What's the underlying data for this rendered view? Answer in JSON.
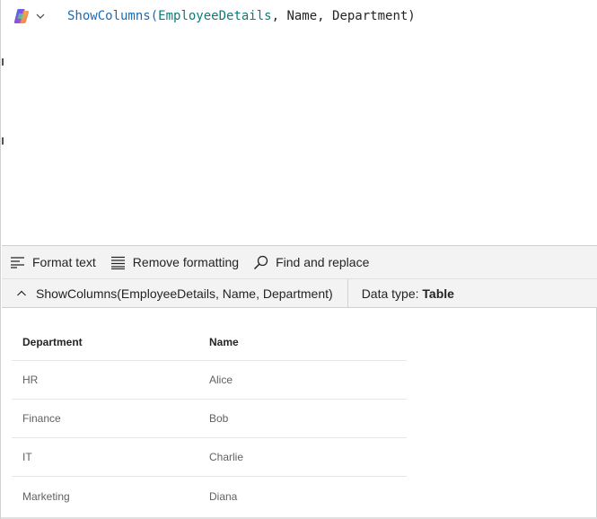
{
  "formula": {
    "function_name": "ShowColumns",
    "open_paren": "(",
    "table_arg": "EmployeeDetails",
    "rest": ", Name, Department)"
  },
  "toolbar": {
    "format_text": "Format text",
    "remove_formatting": "Remove formatting",
    "find_replace": "Find and replace"
  },
  "result": {
    "expression": "ShowColumns(EmployeeDetails, Name, Department)",
    "data_type_label": "Data type:",
    "data_type_value": "Table"
  },
  "table": {
    "headers": [
      "Department",
      "Name"
    ],
    "rows": [
      [
        "HR",
        "Alice"
      ],
      [
        "Finance",
        "Bob"
      ],
      [
        "IT",
        "Charlie"
      ],
      [
        "Marketing",
        "Diana"
      ]
    ]
  },
  "colors": {
    "function": "#1a6cb4",
    "table_ref": "#0e7a7a",
    "toolbar_bg": "#f3f3f3"
  },
  "icons": {
    "copilot": "copilot-icon",
    "chevron": "chevron-down-icon",
    "format": "format-text-icon",
    "remove": "remove-formatting-icon",
    "find": "search-icon",
    "collapse": "chevron-up-icon"
  }
}
